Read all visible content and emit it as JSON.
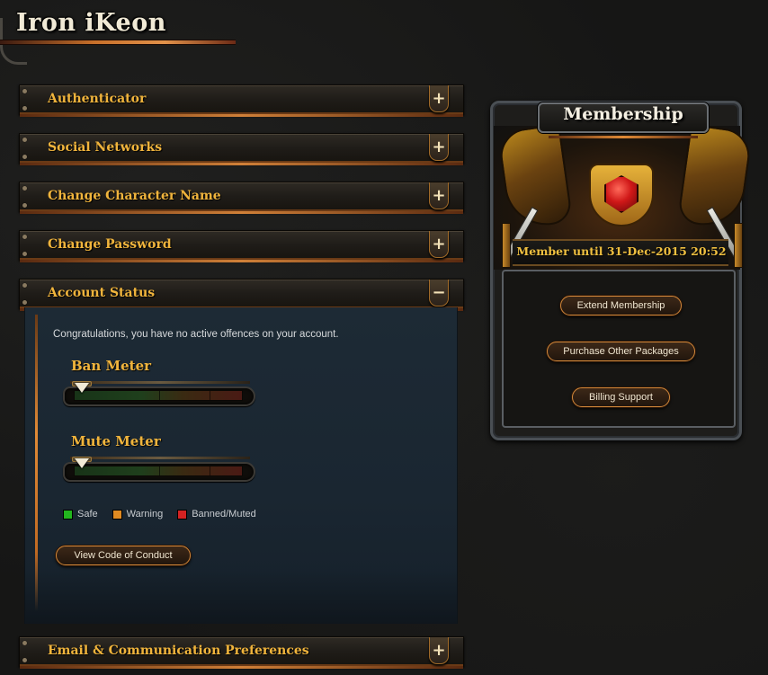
{
  "header": {
    "title": "Iron iKeon"
  },
  "accordion": {
    "authenticator": {
      "label": "Authenticator",
      "toggle": "+"
    },
    "social_networks": {
      "label": "Social Networks",
      "toggle": "+"
    },
    "change_character_name": {
      "label": "Change Character Name",
      "toggle": "+"
    },
    "change_password": {
      "label": "Change Password",
      "toggle": "+"
    },
    "account_status": {
      "label": "Account Status",
      "toggle": "−"
    },
    "email_preferences": {
      "label": "Email & Communication Preferences",
      "toggle": "+"
    }
  },
  "account_status": {
    "message": "Congratulations, you have no active offences on your account.",
    "ban_meter": {
      "title": "Ban Meter",
      "level": 0
    },
    "mute_meter": {
      "title": "Mute Meter",
      "level": 0
    },
    "legend": [
      {
        "label": "Safe",
        "color": "#22b61e"
      },
      {
        "label": "Warning",
        "color": "#e08a22"
      },
      {
        "label": "Banned/Muted",
        "color": "#d42222"
      }
    ],
    "code_of_conduct_button": "View Code of Conduct"
  },
  "membership": {
    "title": "Membership",
    "member_until": "Member until 31-Dec-2015 20:52",
    "buttons": {
      "extend": "Extend Membership",
      "purchase": "Purchase Other Packages",
      "billing": "Billing Support"
    }
  }
}
